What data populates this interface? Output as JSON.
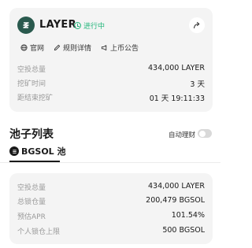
{
  "token": {
    "name": "LAYER",
    "status": "进行中"
  },
  "links": {
    "website": "官网",
    "rules": "规则详情",
    "listing": "上币公告"
  },
  "summary": [
    {
      "label": "空投总量",
      "value": "434,000 LAYER"
    },
    {
      "label": "挖矿时间",
      "value": "3 天"
    },
    {
      "label": "距结束挖矿",
      "value": "01 天 19:11:33"
    }
  ],
  "pools": {
    "title": "池子列表",
    "auto_label": "自动理财",
    "auto_enabled": false,
    "tab_label": "BGSOL 池"
  },
  "pool_details": [
    {
      "label": "空投总量",
      "value": "434,000 LAYER"
    },
    {
      "label": "总锁仓量",
      "value": "200,479 BGSOL"
    },
    {
      "label": "预估APR",
      "value": "101.54%"
    },
    {
      "label": "个人锁仓上限",
      "value": "500 BGSOL"
    }
  ],
  "colors": {
    "status_green": "#21b57a",
    "token_logo": "#2a5a4e",
    "card_bg": "#f4f4f4"
  },
  "icons": [
    "token-logo-icon",
    "check-circle-icon",
    "share-icon",
    "globe-icon",
    "pen-icon",
    "megaphone-icon",
    "pool-logo-icon"
  ]
}
